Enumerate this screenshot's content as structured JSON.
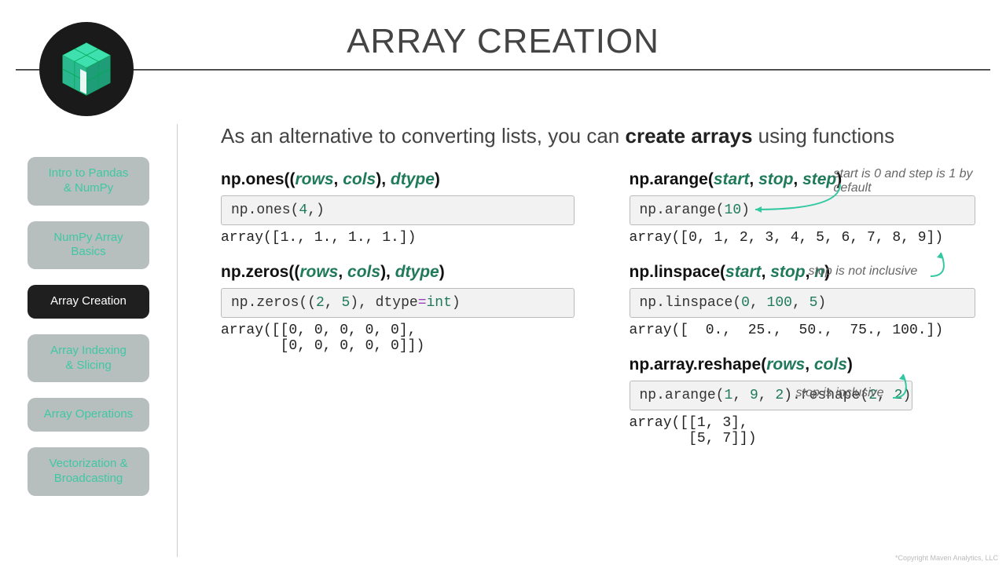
{
  "header": {
    "title": "ARRAY CREATION"
  },
  "sidebar": {
    "items": [
      {
        "label": "Intro to Pandas\n& NumPy",
        "active": false
      },
      {
        "label": "NumPy Array\nBasics",
        "active": false
      },
      {
        "label": "Array Creation",
        "active": true
      },
      {
        "label": "Array Indexing\n& Slicing",
        "active": false
      },
      {
        "label": "Array Operations",
        "active": false
      },
      {
        "label": "Vectorization &\nBroadcasting",
        "active": false
      }
    ]
  },
  "intro": {
    "pre": "As an alternative to converting lists, you can ",
    "bold": "create arrays",
    "post": " using functions"
  },
  "left": {
    "ones_sig_pre": "np.ones((",
    "ones_sig_p1": "rows",
    "ones_sig_p2": "cols",
    "ones_sig_mid": "), ",
    "ones_sig_p3": "dtype",
    "ones_sig_post": ")",
    "ones_code_a": "np.ones(",
    "ones_code_n": "4",
    "ones_code_b": ",)",
    "ones_out": "array([1., 1., 1., 1.])",
    "zeros_sig_pre": "np.zeros((",
    "zeros_sig_p1": "rows",
    "zeros_sig_p2": "cols",
    "zeros_sig_mid": "), ",
    "zeros_sig_p3": "dtype",
    "zeros_sig_post": ")",
    "zeros_code_a": "np.zeros((",
    "zeros_code_n1": "2",
    "zeros_code_m": ", ",
    "zeros_code_n2": "5",
    "zeros_code_b": "), dtype",
    "zeros_code_eq": "=",
    "zeros_code_kw": "int",
    "zeros_code_c": ")",
    "zeros_out": "array([[0, 0, 0, 0, 0],\n       [0, 0, 0, 0, 0]])"
  },
  "right": {
    "arange_sig_pre": "np.arange(",
    "arange_p1": "start",
    "arange_p2": "stop",
    "arange_p3": "step",
    "arange_sig_post": ")",
    "arange_code_a": "np.arange(",
    "arange_code_n": "10",
    "arange_code_b": ")",
    "arange_out": "array([0, 1, 2, 3, 4, 5, 6, 7, 8, 9])",
    "note_start": "start is 0 and step is 1 by default",
    "note_stop1": "stop is not inclusive",
    "lin_sig_pre": "np.linspace(",
    "lin_p1": "start",
    "lin_p2": "stop",
    "lin_p3": "n",
    "lin_sig_post": ")",
    "lin_code_a": "np.linspace(",
    "lin_code_n1": "0",
    "lin_code_m1": ", ",
    "lin_code_n2": "100",
    "lin_code_m2": ", ",
    "lin_code_n3": "5",
    "lin_code_b": ")",
    "lin_out": "array([  0.,  25.,  50.,  75., 100.])",
    "note_stop2": "stop is inclusive",
    "reshape_sig_pre": "np.array.reshape(",
    "reshape_p1": "rows",
    "reshape_p2": "cols",
    "reshape_sig_post": ")",
    "reshape_code_a": "np.arange(",
    "reshape_code_n1": "1",
    "reshape_code_m1": ", ",
    "reshape_code_n2": "9",
    "reshape_code_m2": ", ",
    "reshape_code_n3": "2",
    "reshape_code_b": ").reshape(",
    "reshape_code_n4": "2",
    "reshape_code_m3": ", ",
    "reshape_code_n5": "2",
    "reshape_code_c": ")",
    "reshape_out": "array([[1, 3],\n       [5, 7]])"
  },
  "copyright": "*Copyright Maven Analytics, LLC"
}
